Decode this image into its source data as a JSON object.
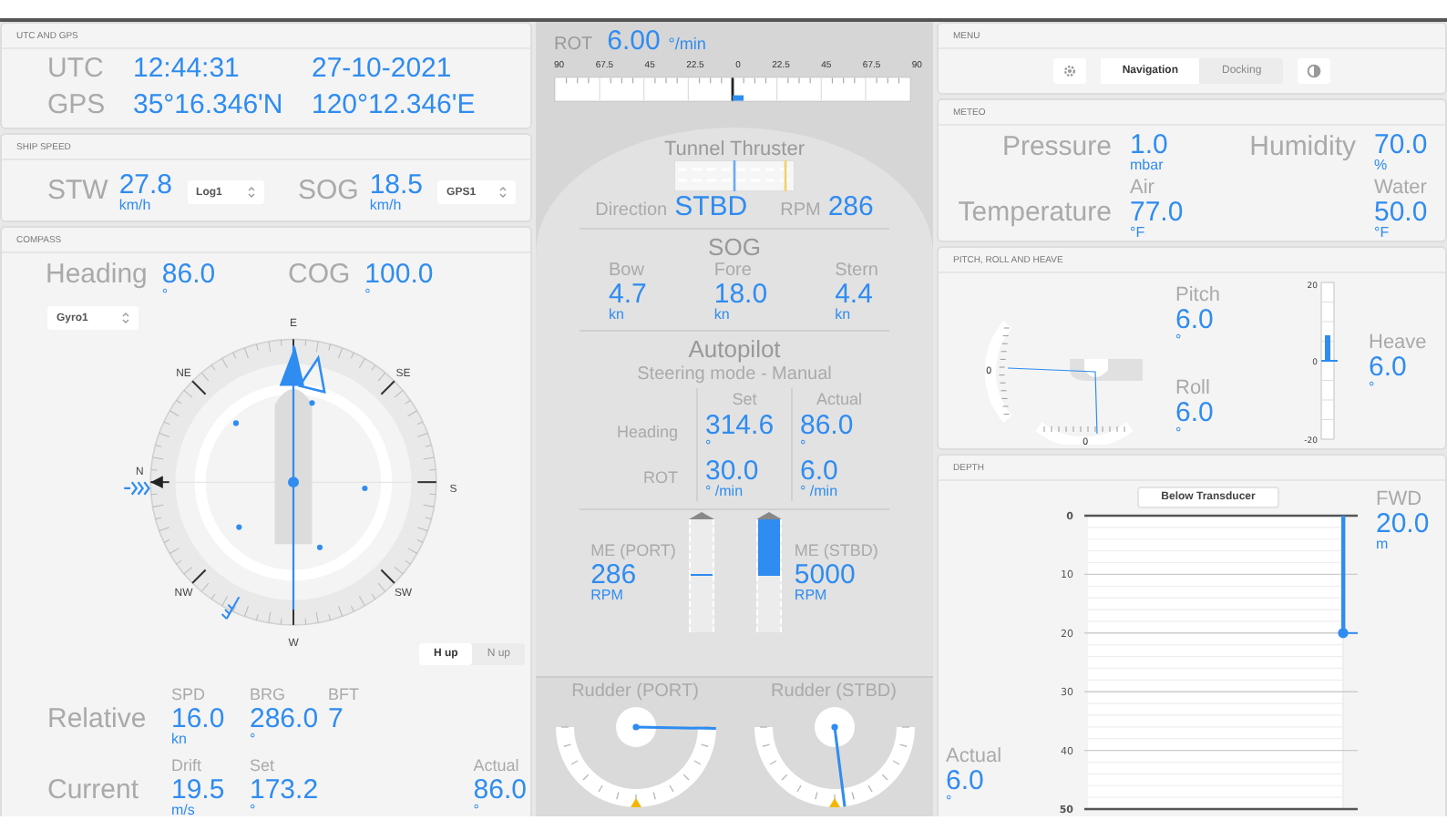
{
  "utc_gps": {
    "title": "UTC AND GPS",
    "rows": [
      {
        "label": "UTC",
        "value_1": "12:44:31",
        "value_2": "27-10-2021"
      },
      {
        "label": "GPS",
        "value_1": "35°16.346'N",
        "value_2": "120°12.346'E"
      }
    ]
  },
  "ship_speed": {
    "title": "SHIP SPEED",
    "items": [
      {
        "label": "STW",
        "value": "27.8",
        "unit": "km/h",
        "source": "Log1"
      },
      {
        "label": "SOG",
        "value": "18.5",
        "unit": "km/h",
        "source": "GPS1"
      }
    ]
  },
  "compass": {
    "title": "COMPASS",
    "readouts": [
      {
        "label": "Heading",
        "value": "86.0",
        "unit": "°"
      },
      {
        "label": "COG",
        "value": "100.0",
        "unit": "°"
      }
    ],
    "source": "Gyro1",
    "cardinals": [
      "E",
      "SE",
      "S",
      "SW",
      "W",
      "NW",
      "N",
      "NE"
    ],
    "orientation": [
      {
        "label": "H up",
        "selected": true
      },
      {
        "label": "N up",
        "selected": false
      }
    ],
    "relative": {
      "label": "Relative",
      "fields": [
        {
          "label": "SPD",
          "value": "16.0",
          "unit": "kn"
        },
        {
          "label": "BRG",
          "value": "286.0",
          "unit": "°"
        },
        {
          "label": "BFT",
          "value": "7"
        }
      ]
    },
    "current": {
      "label": "Current",
      "fields": [
        {
          "label": "Drift",
          "value": "19.5",
          "unit": "m/s"
        },
        {
          "label": "Set",
          "value": "173.2",
          "unit": "°"
        }
      ]
    },
    "actual": {
      "label": "Actual",
      "value": "86.0",
      "unit": "°"
    }
  },
  "rot": {
    "label": "ROT",
    "value": "6.00",
    "unit": "°/min",
    "scale": [
      "90",
      "67.5",
      "45",
      "22.5",
      "0",
      "22.5",
      "45",
      "67.5",
      "90"
    ]
  },
  "tunnel_thruster": {
    "title": "Tunnel Thruster",
    "direction_label": "Direction",
    "direction": "STBD",
    "rpm_label": "RPM",
    "rpm": "286"
  },
  "sog": {
    "title": "SOG",
    "items": [
      {
        "label": "Bow",
        "value": "4.7",
        "unit": "kn"
      },
      {
        "label": "Fore",
        "value": "18.0",
        "unit": "kn"
      },
      {
        "label": "Stern",
        "value": "4.4",
        "unit": "kn"
      }
    ]
  },
  "autopilot": {
    "title": "Autopilot",
    "mode": "Steering mode - Manual",
    "columns": [
      "Set",
      "Actual"
    ],
    "rows": [
      {
        "label": "Heading",
        "cells": [
          {
            "value": "314.6",
            "unit": "°"
          },
          {
            "value": "86.0",
            "unit": "°"
          }
        ]
      },
      {
        "label": "ROT",
        "cells": [
          {
            "value": "30.0",
            "unit": "° /min"
          },
          {
            "value": "6.0",
            "unit": "° /min"
          }
        ]
      }
    ]
  },
  "engines": [
    {
      "label": "ME (PORT)",
      "value": "286",
      "unit": "RPM",
      "level": 0.03
    },
    {
      "label": "ME (STBD)",
      "value": "5000",
      "unit": "RPM",
      "level": 1.0
    }
  ],
  "rudders": [
    {
      "label": "Rudder (PORT)",
      "level": 0.98
    },
    {
      "label": "Rudder (STBD)",
      "level": 0.54
    }
  ],
  "menu": {
    "title": "MENU",
    "tabs": [
      {
        "label": "Navigation",
        "selected": true
      },
      {
        "label": "Docking",
        "selected": false
      }
    ]
  },
  "meteo": {
    "title": "METEO",
    "pressure": {
      "label": "Pressure",
      "value": "1.0",
      "unit": "mbar"
    },
    "humidity": {
      "label": "Humidity",
      "value": "70.0",
      "unit": "%"
    },
    "temperature": {
      "label": "Temperature",
      "items": [
        {
          "label": "Air",
          "value": "77.0",
          "unit": "°F"
        },
        {
          "label": "Water",
          "value": "50.0",
          "unit": "°F"
        }
      ]
    }
  },
  "motion": {
    "title": "PITCH, ROLL AND HEAVE",
    "pitch_zero": "0",
    "roll_zero": "0",
    "heave_scale": [
      "20",
      "0",
      "-20"
    ],
    "readouts": [
      {
        "label": "Pitch",
        "value": "6.0",
        "unit": "°"
      },
      {
        "label": "Roll",
        "value": "6.0",
        "unit": "°"
      }
    ],
    "heave": {
      "label": "Heave",
      "value": "6.0",
      "unit": "°"
    }
  },
  "depth": {
    "title": "DEPTH",
    "mode_button": "Below Transducer",
    "fwd": {
      "value": "20.0",
      "unit": "m"
    },
    "actual": {
      "label": "Actual",
      "value": "6.0",
      "unit": "°"
    },
    "chart_data": {
      "type": "bar",
      "orientation": "vertical",
      "ylim": [
        50,
        0
      ],
      "yticks": [
        0,
        10,
        20,
        30,
        40,
        50
      ],
      "grid": true,
      "series": [
        {
          "name": "FWD",
          "color": "#2f8cf0",
          "values": [
            20
          ]
        }
      ]
    }
  }
}
